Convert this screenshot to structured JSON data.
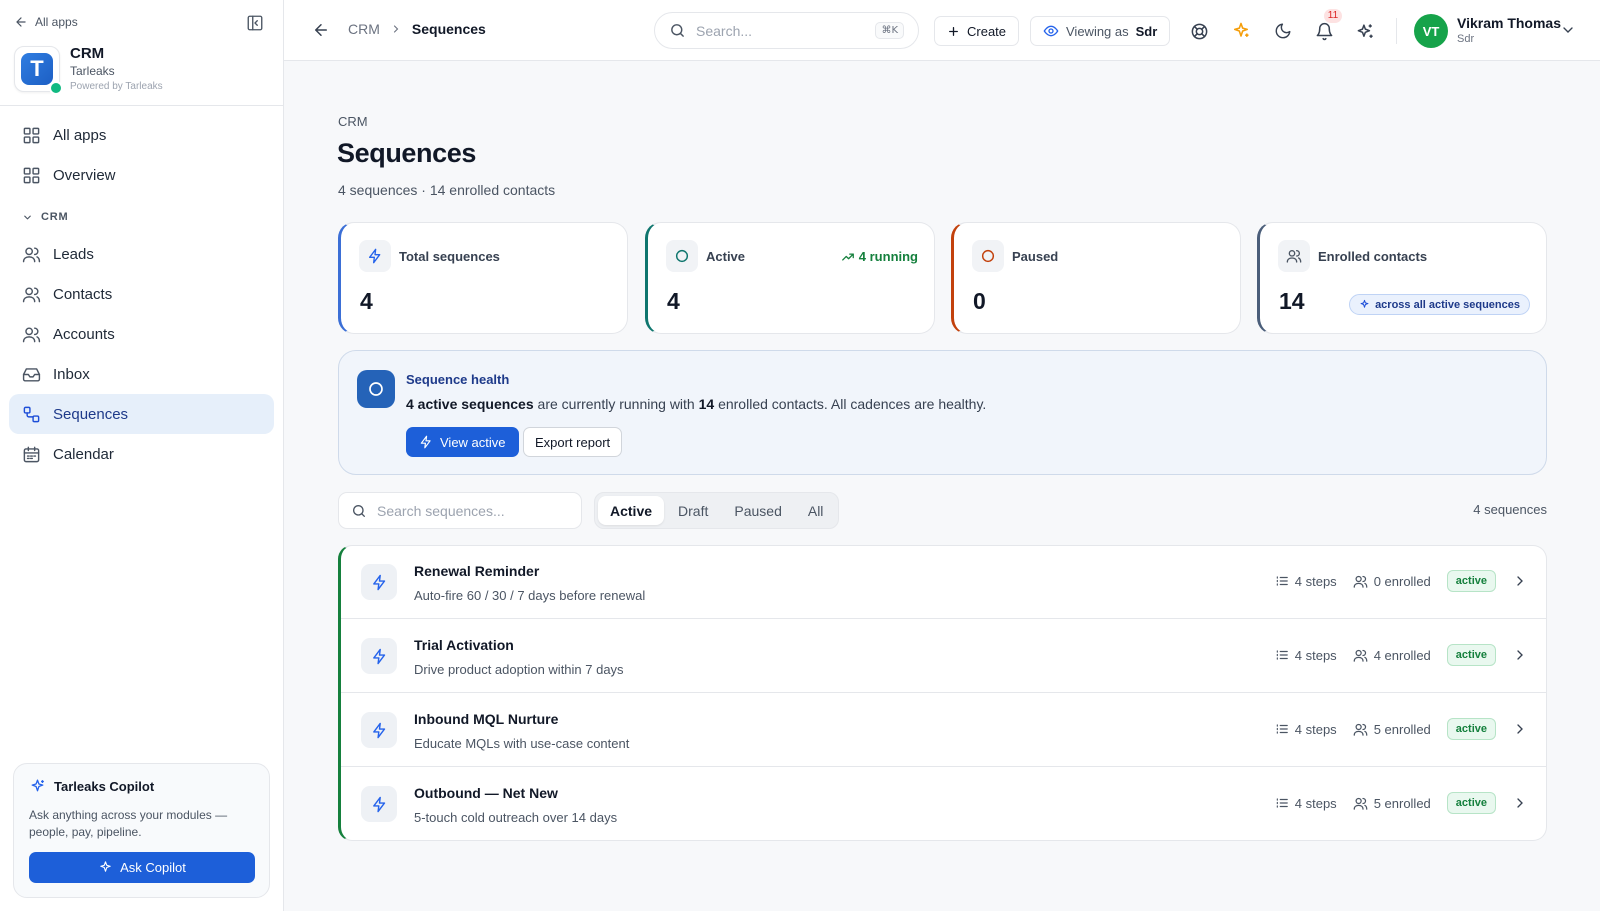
{
  "sidebar": {
    "all_apps_link": "All apps",
    "brand": {
      "name": "CRM",
      "org": "Tarleaks",
      "powered": "Powered by Tarleaks",
      "logo_letter": "T"
    },
    "nav_top": [
      {
        "label": "All apps",
        "icon": "grid-icon"
      },
      {
        "label": "Overview",
        "icon": "grid-icon"
      }
    ],
    "section_label": "CRM",
    "nav_crm": [
      {
        "label": "Leads",
        "icon": "users-icon"
      },
      {
        "label": "Contacts",
        "icon": "users-icon"
      },
      {
        "label": "Accounts",
        "icon": "users-icon"
      },
      {
        "label": "Inbox",
        "icon": "inbox-icon"
      },
      {
        "label": "Sequences",
        "icon": "sequence-icon",
        "active": true
      },
      {
        "label": "Calendar",
        "icon": "calendar-icon"
      }
    ],
    "copilot": {
      "title": "Tarleaks Copilot",
      "description": "Ask anything across your modules — people, pay, pipeline.",
      "button": "Ask Copilot"
    }
  },
  "topbar": {
    "breadcrumb": [
      "CRM",
      "Sequences"
    ],
    "search_placeholder": "Search...",
    "search_shortcut": "⌘K",
    "create_label": "Create",
    "viewing_label": "Viewing as",
    "viewing_value": "Sdr",
    "notification_count": "11",
    "user": {
      "initials": "VT",
      "name": "Vikram Thomas",
      "role": "Sdr"
    }
  },
  "page": {
    "breadcrumb": "CRM",
    "title": "Sequences",
    "subtitle": "4 sequences · 14 enrolled contacts"
  },
  "stats": [
    {
      "label": "Total sequences",
      "value": "4",
      "icon": "bolt-icon",
      "accent": "#3b6fd6"
    },
    {
      "label": "Active",
      "value": "4",
      "icon": "circle-icon",
      "accent": "#0f766e",
      "trend": "4 running"
    },
    {
      "label": "Paused",
      "value": "0",
      "icon": "circle-icon",
      "accent": "#c2410c"
    },
    {
      "label": "Enrolled contacts",
      "value": "14",
      "icon": "users-icon",
      "accent": "#4b5e7a",
      "chip": "across all active sequences"
    }
  ],
  "health": {
    "title": "Sequence health",
    "message_bold_1": "4 active sequences",
    "message_1": " are currently running with ",
    "message_bold_2": "14",
    "message_2": " enrolled contacts. All cadences are healthy.",
    "primary_button": "View active",
    "secondary_button": "Export report"
  },
  "filters": {
    "search_placeholder": "Search sequences...",
    "tabs": [
      "Active",
      "Draft",
      "Paused",
      "All"
    ],
    "active_tab": "Active",
    "count_label": "4 sequences"
  },
  "sequences": [
    {
      "name": "Renewal Reminder",
      "description": "Auto-fire 60 / 30 / 7 days before renewal",
      "steps": "4 steps",
      "enrolled": "0 enrolled",
      "status": "active"
    },
    {
      "name": "Trial Activation",
      "description": "Drive product adoption within 7 days",
      "steps": "4 steps",
      "enrolled": "4 enrolled",
      "status": "active"
    },
    {
      "name": "Inbound MQL Nurture",
      "description": "Educate MQLs with use-case content",
      "steps": "4 steps",
      "enrolled": "5 enrolled",
      "status": "active"
    },
    {
      "name": "Outbound — Net New",
      "description": "5-touch cold outreach over 14 days",
      "steps": "4 steps",
      "enrolled": "5 enrolled",
      "status": "active"
    }
  ],
  "colors": {
    "primary": "#1d5fd9",
    "active_green": "#15803d",
    "sidebar_active_bg": "#e6effa"
  }
}
